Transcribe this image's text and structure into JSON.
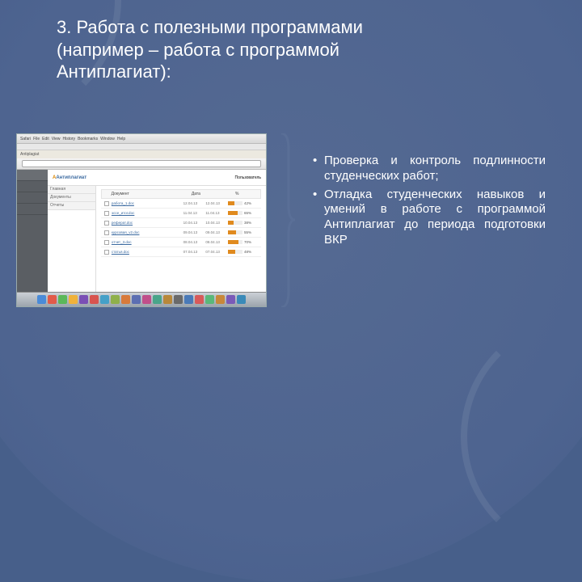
{
  "title": {
    "line1": "3. Работа с полезными программами",
    "line2": "(например – работа с программой",
    "line3": "Антиплагиат):"
  },
  "bullets": [
    "Проверка и контроль подлинности студенческих работ;",
    "Отладка студенческих навыков и умений в работе с программой Антиплагиат до периода подготовки ВКР"
  ],
  "screenshot": {
    "menu": [
      "Safari",
      "File",
      "Edit",
      "View",
      "History",
      "Bookmarks",
      "Window",
      "Help"
    ],
    "tab_title": "Antiplagiat",
    "brand_text": "Антиплагиат",
    "user_label": "Пользователь",
    "sidenav": [
      "Главная",
      "Документы",
      "Отчеты"
    ],
    "table": {
      "head_doc": "Документ",
      "head_date": "Дата",
      "head_pct": "%"
    },
    "rows": [
      {
        "name": "работа_1.doc",
        "date1": "12.04.13",
        "date2": "12.04.13",
        "pct": 42
      },
      {
        "name": "эссе_итог.doc",
        "date1": "11.04.13",
        "date2": "11.04.13",
        "pct": 65
      },
      {
        "name": "реферат.doc",
        "date1": "10.04.13",
        "date2": "10.04.13",
        "pct": 38
      },
      {
        "name": "курсовая_v2.doc",
        "date1": "09.04.13",
        "date2": "09.04.13",
        "pct": 55
      },
      {
        "name": "отчет_3.doc",
        "date1": "08.04.13",
        "date2": "08.04.13",
        "pct": 70
      },
      {
        "name": "статья.doc",
        "date1": "07.04.13",
        "date2": "07.04.13",
        "pct": 48
      }
    ]
  }
}
